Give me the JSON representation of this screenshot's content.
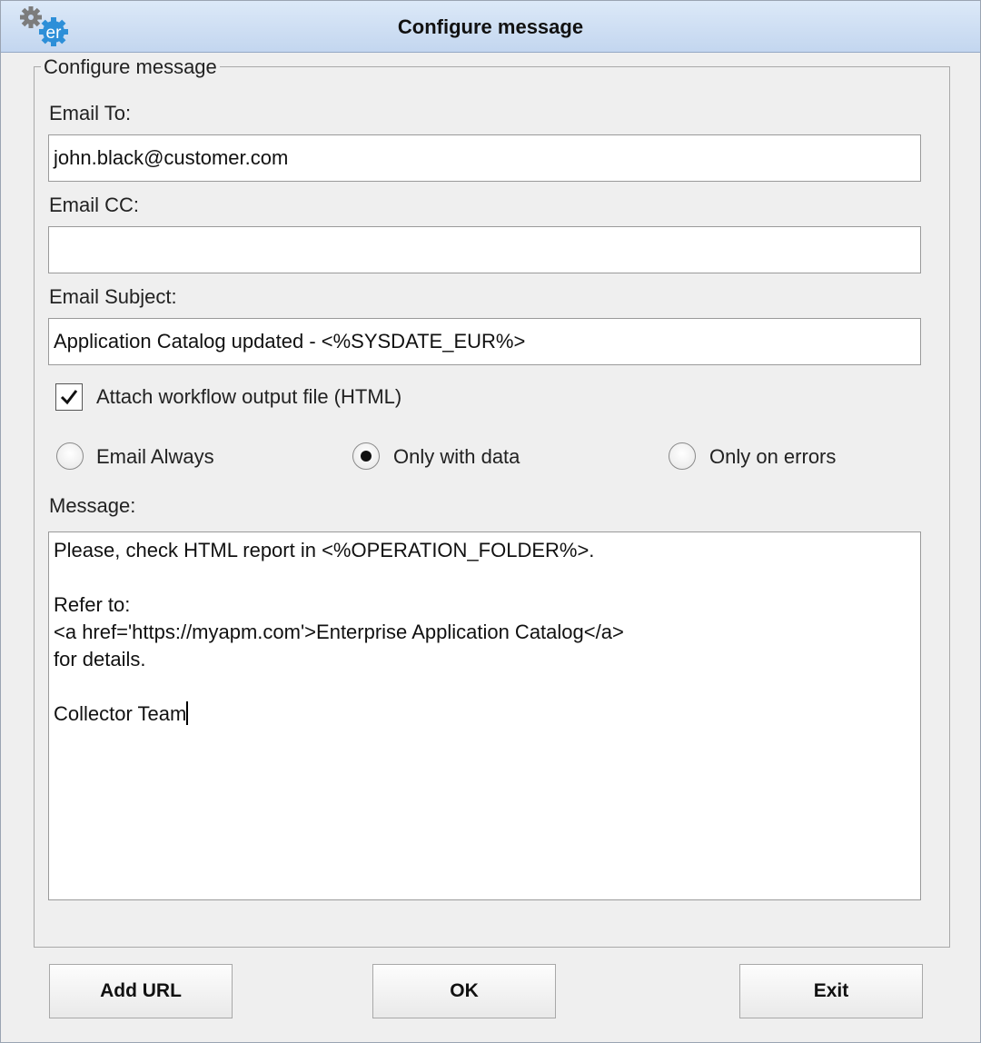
{
  "window": {
    "title": "Configure message",
    "logo_icon": "er-gear-logo-icon",
    "logo_text": "er"
  },
  "group": {
    "legend": "Configure message"
  },
  "email_to": {
    "label": "Email To:",
    "value": "john.black@customer.com"
  },
  "email_cc": {
    "label": "Email CC:",
    "value": ""
  },
  "email_subject": {
    "label": "Email Subject:",
    "value": "Application Catalog updated - <%SYSDATE_EUR%>"
  },
  "attach": {
    "label": "Attach workflow output file (HTML)",
    "checked": true
  },
  "send_mode": {
    "selected": "only_with_data",
    "options": [
      {
        "id": "email_always",
        "label": "Email Always"
      },
      {
        "id": "only_with_data",
        "label": "Only with data"
      },
      {
        "id": "only_on_errors",
        "label": "Only on errors"
      }
    ]
  },
  "message": {
    "label": "Message:",
    "lines": [
      "Please, check HTML report in <%OPERATION_FOLDER%>.",
      "",
      "Refer to:",
      "<a href='https://myapm.com'>Enterprise Application Catalog</a>",
      "for details.",
      "",
      "Collector Team"
    ]
  },
  "buttons": {
    "add_url": "Add URL",
    "ok": "OK",
    "exit": "Exit"
  }
}
